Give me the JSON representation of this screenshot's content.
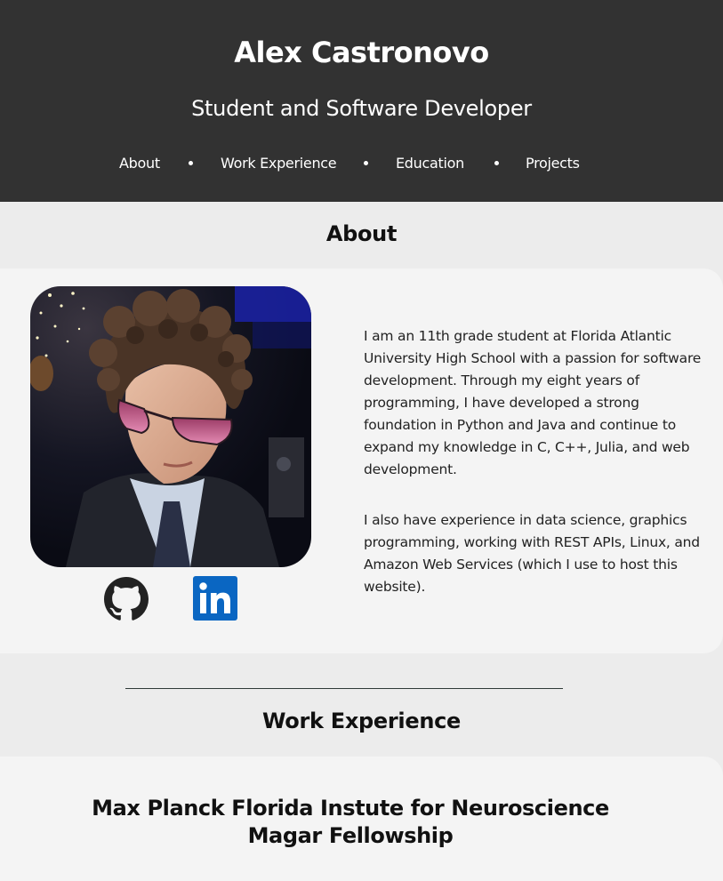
{
  "header": {
    "title": "Alex Castronovo",
    "subtitle": "Student and Software Developer",
    "nav": [
      {
        "label": "About"
      },
      {
        "label": "Work Experience"
      },
      {
        "label": "Education"
      },
      {
        "label": "Projects"
      }
    ]
  },
  "about": {
    "heading": "About",
    "paragraphs": [
      "I am an 11th grade student at Florida Atlantic University High School with a passion for software development. Through my eight years of programming, I have developed a strong foundation in Python and Java and continue to expand my knowledge in C, C++, Julia, and web development.",
      "I also have experience in data science, graphics programming, working with REST APIs, Linux, and Amazon Web Services (which I use to host this website)."
    ],
    "social": [
      {
        "icon": "github-icon"
      },
      {
        "icon": "linkedin-icon",
        "color": "#0a66c2"
      }
    ]
  },
  "work": {
    "heading": "Work Experience",
    "jobs": [
      {
        "organization": "Max Planck Florida Instute for Neuroscience",
        "title": "Magar Fellowship"
      }
    ]
  },
  "colors": {
    "header_bg": "#323232",
    "page_bg": "#ececec",
    "card_bg": "#f4f4f4",
    "linkedin_blue": "#0a66c2"
  }
}
